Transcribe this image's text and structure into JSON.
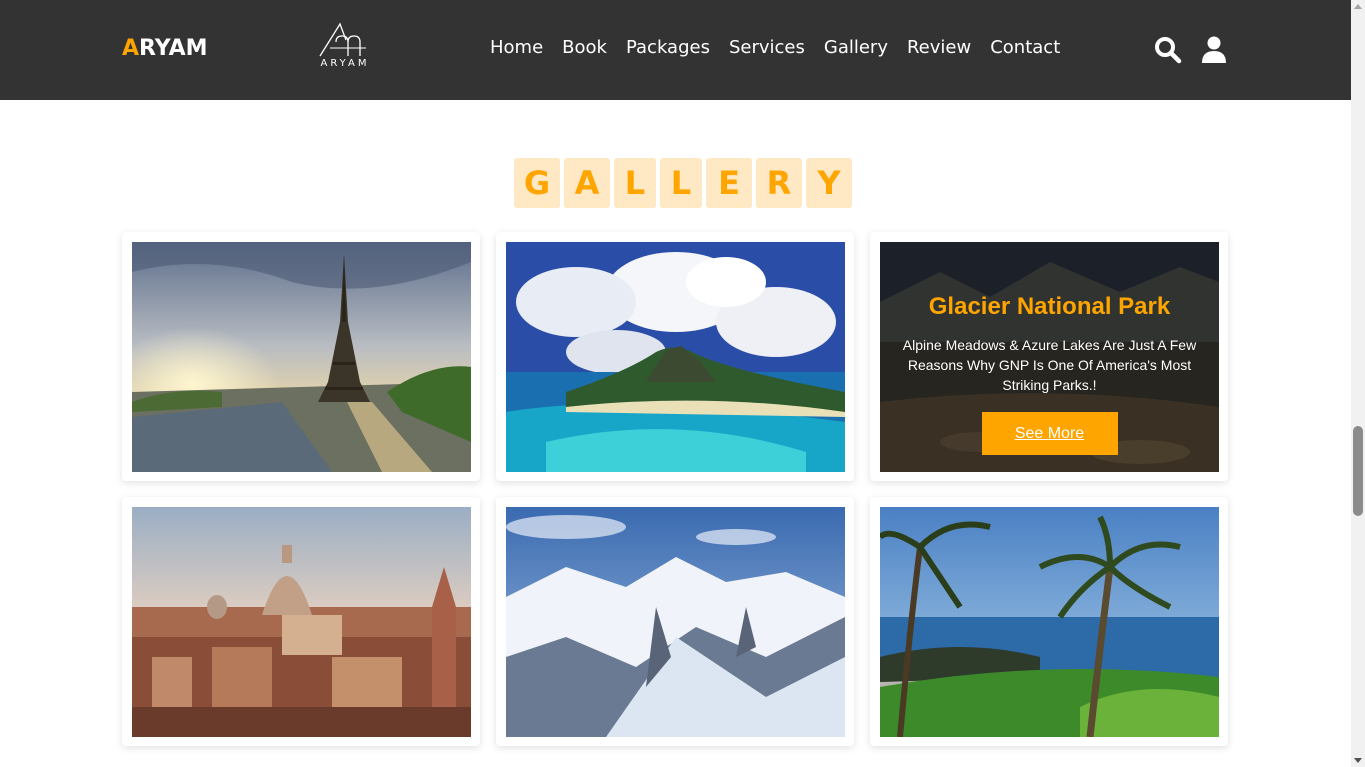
{
  "header": {
    "brand_accent": "A",
    "brand_rest": "RYAM",
    "logo_text": "ARYAM",
    "nav": [
      "Home",
      "Book",
      "Packages",
      "Services",
      "Gallery",
      "Review",
      "Contact"
    ],
    "search_icon": "search-icon",
    "user_icon": "user-icon"
  },
  "gallery": {
    "heading_letters": [
      "G",
      "A",
      "L",
      "L",
      "E",
      "R",
      "Y"
    ],
    "featured": {
      "title": "Glacier National Park",
      "description": "Alpine Meadows & Azure Lakes Are Just A Few Reasons Why GNP Is One Of America's Most Striking Parks.!",
      "button_label": "See More"
    },
    "images": [
      "eiffel-tower-photo",
      "tropical-island-photo",
      "glacier-lake-photo",
      "rome-city-photo",
      "snowy-mountains-photo",
      "palm-beach-photo"
    ]
  },
  "colors": {
    "accent": "#ffa500",
    "header_bg": "#333333",
    "heading_tile_bg": "#ffe8c4"
  }
}
